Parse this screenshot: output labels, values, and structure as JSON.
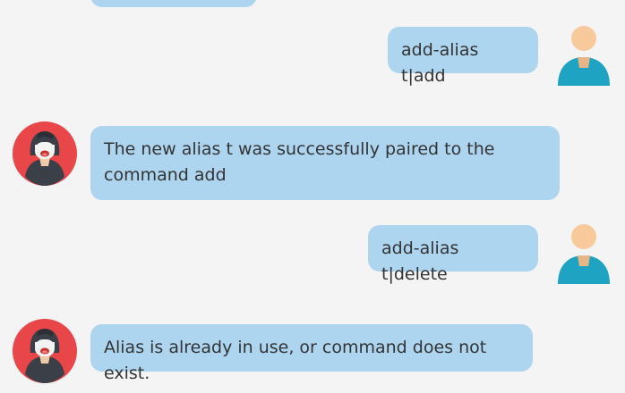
{
  "colors": {
    "background": "#f4f4f4",
    "bubble": "#add5f0",
    "text": "#333333",
    "bot_avatar_bg": "#e9464a",
    "user_avatar_skin": "#f8c99a",
    "user_avatar_shirt": "#1ea3c2"
  },
  "messages": [
    {
      "id": "m0",
      "sender": "bot",
      "text": "",
      "partial": true
    },
    {
      "id": "m1",
      "sender": "user",
      "avatar_icon": "user-avatar-icon",
      "text": "add-alias t|add"
    },
    {
      "id": "m2",
      "sender": "bot",
      "avatar_icon": "bot-avatar-icon",
      "text": "The new alias t was successfully paired to the command add"
    },
    {
      "id": "m3",
      "sender": "user",
      "avatar_icon": "user-avatar-icon",
      "text": "add-alias t|delete"
    },
    {
      "id": "m4",
      "sender": "bot",
      "avatar_icon": "bot-avatar-icon",
      "text": "Alias is already in use, or command does not exist."
    }
  ]
}
